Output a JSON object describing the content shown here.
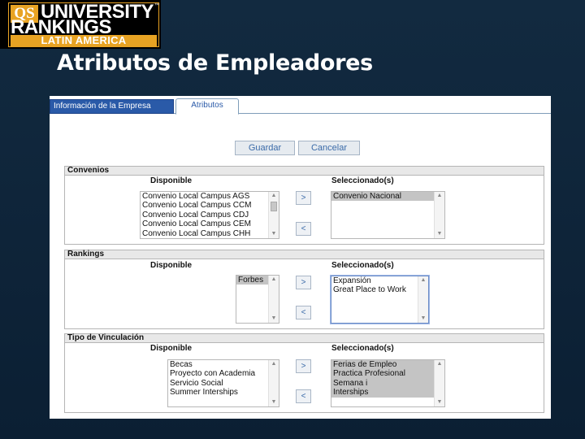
{
  "logo": {
    "badge": "QS",
    "line1": "UNIVERSITY",
    "line2": "RANKINGS",
    "tm": "™",
    "region": "LATIN AMERICA"
  },
  "title": "Atributos de Empleadores",
  "tabs": [
    {
      "label": "Información de la Empresa",
      "active": true
    },
    {
      "label": "Atributos",
      "active": false
    }
  ],
  "toolbar": {
    "save_label": "Guardar",
    "cancel_label": "Cancelar"
  },
  "col_available": "Disponible",
  "col_selected": "Seleccionado(s)",
  "move_right": ">",
  "move_left": "<",
  "sections": [
    {
      "title": "Convenios",
      "available": [
        "Convenio Local Campus AGS",
        "Convenio Local Campus CCM",
        "Convenio Local Campus CDJ",
        "Convenio Local Campus CEM",
        "Convenio Local Campus CHH"
      ],
      "selected": [
        "Convenio Nacional"
      ]
    },
    {
      "title": "Rankings",
      "available": [
        "Forbes"
      ],
      "selected": [
        "Expansión",
        "Great Place to Work"
      ]
    },
    {
      "title": "Tipo de Vinculación",
      "available": [
        "Becas",
        "Proyecto con Academia",
        "Servicio Social",
        "Summer Interships"
      ],
      "selected": [
        "Ferias de Empleo",
        "Practica Profesional",
        "Semana i",
        "Interships"
      ]
    }
  ],
  "colors": {
    "background": "#0d2236",
    "accent": "#e8a323",
    "tab_active": "#2a5aa8",
    "button_text": "#3a6aa8"
  }
}
